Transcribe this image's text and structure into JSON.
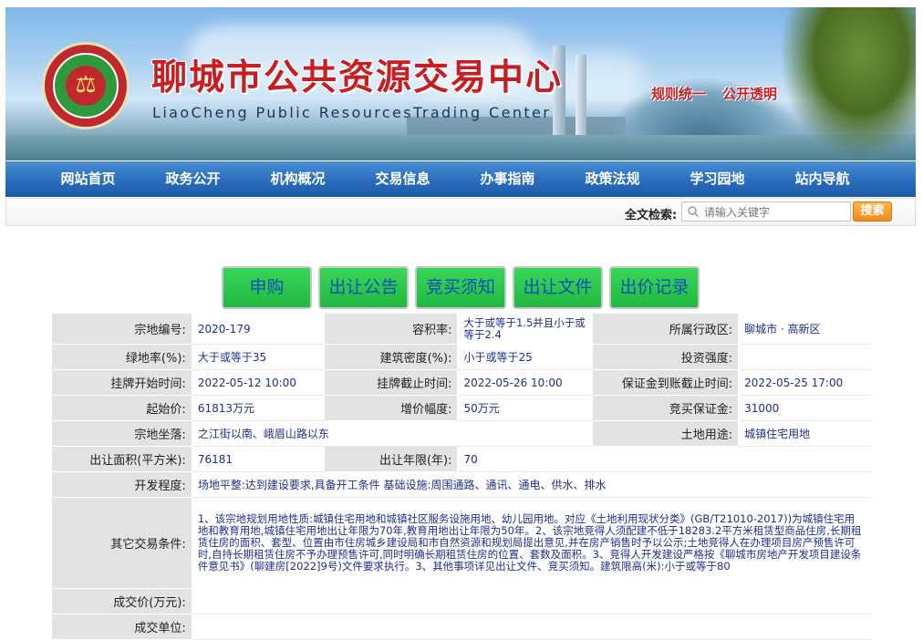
{
  "header": {
    "title": "聊城市公共资源交易中心",
    "subtitle": "LiaoCheng Public ResourcesTrading Center",
    "slogans": [
      "规则统一",
      "公开透明"
    ]
  },
  "nav": {
    "items": [
      "网站首页",
      "政务公开",
      "机构概况",
      "交易信息",
      "办事指南",
      "政策法规",
      "学习园地",
      "站内导航"
    ]
  },
  "search": {
    "label": "全文检索:",
    "placeholder": "请输入关键字",
    "button": "搜索"
  },
  "actions": {
    "buttons": [
      "申购",
      "出让公告",
      "竞买须知",
      "出让文件",
      "出价记录"
    ]
  },
  "detail": {
    "parcel_no_label": "宗地编号:",
    "parcel_no": "2020-179",
    "far_label": "容积率:",
    "far": "大于或等于1.5并且小于或等于2.4",
    "district_label": "所属行政区:",
    "district": "聊城市 · 高新区",
    "green_label": "绿地率(%):",
    "green": "大于或等于35",
    "density_label": "建筑密度(%):",
    "density": "小于或等于25",
    "invest_label": "投资强度:",
    "invest": "",
    "listing_start_label": "挂牌开始时间:",
    "listing_start": "2022-05-12 10:00",
    "listing_end_label": "挂牌截止时间:",
    "listing_end": "2022-05-26 10:00",
    "deposit_deadline_label": "保证金到账截止时间:",
    "deposit_deadline": "2022-05-25 17:00",
    "start_price_label": "起始价:",
    "start_price": "61813万元",
    "increment_label": "增价幅度:",
    "increment": "50万元",
    "bid_deposit_label": "竞买保证金:",
    "bid_deposit": "31000",
    "location_label": "宗地坐落:",
    "location": "之江街以南、峨眉山路以东",
    "land_use_label": "土地用途:",
    "land_use": "城镇住宅用地",
    "area_label": "出让面积(平方米):",
    "area": "76181",
    "term_label": "出让年限(年):",
    "term": "70",
    "development_label": "开发程度:",
    "development": "场地平整:达到建设要求,具备开工条件 基础设施:周围通路、通讯、通电、供水、排水",
    "conditions_label": "其它交易条件:",
    "conditions": "1、该宗地规划用地性质:城镇住宅用地和城镇社区服务设施用地、幼儿园用地。对应《土地利用现状分类》(GB/T21010-2017))为城镇住宅用地和教育用地,城镇住宅用地出让年限为70年,教育用地出让年限为50年。2、该宗地竞得人须配建不低于18283.2平方米租赁型商品住房,长期租赁住房的面积、套型、位置由市住房城乡建设局和市自然资源和规划局提出意见,并在房产销售时予以公示;土地竞得人在办理项目房产预售许可时,自持长期租赁住房不予办理预售许可,同时明确长期租赁住房的位置、套数及面积。3、竞得人开发建设严格按《聊城市房地产开发项目建设条件意见书》(聊建房[2022]9号)文件要求执行。3、其他事项详见出让文件、竞买须知。建筑限高(米):小于或等于80",
    "deal_price_label": "成交价(万元):",
    "deal_price": "",
    "deal_unit_label": "成交单位:",
    "deal_unit": ""
  }
}
